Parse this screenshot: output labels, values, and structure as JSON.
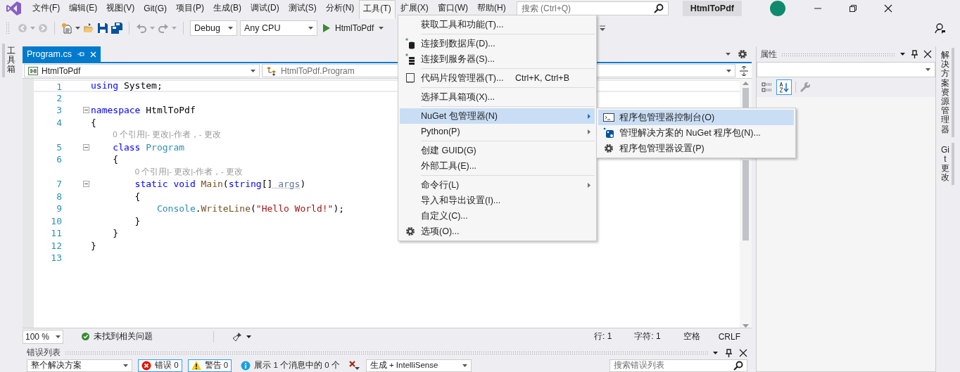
{
  "menu_bar": {
    "items": [
      {
        "label": "文件(F)",
        "selected": false
      },
      {
        "label": "编辑(E)",
        "selected": false
      },
      {
        "label": "视图(V)",
        "selected": false
      },
      {
        "label": "Git(G)",
        "selected": false
      },
      {
        "label": "项目(P)",
        "selected": false
      },
      {
        "label": "生成(B)",
        "selected": false
      },
      {
        "label": "调试(D)",
        "selected": false
      },
      {
        "label": "测试(S)",
        "selected": false
      },
      {
        "label": "分析(N)",
        "selected": false
      },
      {
        "label": "工具(T)",
        "selected": true
      },
      {
        "label": "扩展(X)",
        "selected": false
      },
      {
        "label": "窗口(W)",
        "selected": false
      },
      {
        "label": "帮助(H)",
        "selected": false
      }
    ]
  },
  "search": {
    "placeholder": "搜索 (Ctrl+Q)"
  },
  "window": {
    "title": "HtmlToPdf"
  },
  "toolbar": {
    "configuration": "Debug",
    "platform": "Any CPU",
    "start_target": "HtmlToPdf"
  },
  "left_strip": {
    "tabs": [
      "工具箱"
    ]
  },
  "editor": {
    "tabs": [
      {
        "label": "Program.cs",
        "selected": true
      }
    ],
    "project_dropdown": "HtmlToPdf",
    "member_dropdown": "HtmlToPdf.Program",
    "lines": [
      {
        "number": "1",
        "current": true,
        "fold": false,
        "tokens": [
          {
            "kind": "keyword",
            "text": "using"
          },
          {
            "kind": "plain",
            "text": " System;"
          }
        ]
      },
      {
        "number": "2",
        "current": false,
        "fold": false
      },
      {
        "number": "3",
        "current": false,
        "fold": true,
        "tokens": [
          {
            "kind": "keyword",
            "text": "namespace"
          },
          {
            "kind": "plain",
            "text": " HtmlToPdf"
          }
        ]
      },
      {
        "number": "4",
        "current": false,
        "fold": false,
        "tokens": [
          {
            "kind": "plain",
            "text": "{"
          }
        ]
      },
      {
        "number": "5",
        "current": false,
        "fold": true,
        "lens": "0 个引用|- 更改|-作者，- 更改",
        "tokens": [
          {
            "kind": "keyword",
            "text": "    class"
          },
          {
            "kind": "type",
            "text": " Program"
          }
        ]
      },
      {
        "number": "6",
        "current": false,
        "fold": false,
        "tokens": [
          {
            "kind": "plain",
            "text": "    {"
          }
        ]
      },
      {
        "number": "7",
        "current": false,
        "fold": true,
        "lens": "0 个引用|- 更改|-作者，- 更改",
        "tokens": [
          {
            "kind": "keyword",
            "text": "        static"
          },
          {
            "kind": "keyword",
            "text": " void"
          },
          {
            "kind": "method",
            "text": " Main"
          },
          {
            "kind": "plain",
            "text": "("
          },
          {
            "kind": "keyword",
            "text": "string"
          },
          {
            "kind": "plain",
            "text": "[]"
          },
          {
            "kind": "param",
            "text": " args"
          },
          {
            "kind": "plain",
            "text": ")"
          }
        ]
      },
      {
        "number": "8",
        "current": false,
        "fold": false,
        "tokens": [
          {
            "kind": "plain",
            "text": "        {"
          }
        ]
      },
      {
        "number": "9",
        "current": false,
        "fold": false,
        "tokens": [
          {
            "kind": "type",
            "text": "            Console"
          },
          {
            "kind": "plain",
            "text": "."
          },
          {
            "kind": "method",
            "text": "WriteLine"
          },
          {
            "kind": "plain",
            "text": "("
          },
          {
            "kind": "string",
            "text": "\"Hello World!\""
          },
          {
            "kind": "plain",
            "text": ");"
          }
        ]
      },
      {
        "number": "10",
        "current": false,
        "fold": false,
        "tokens": [
          {
            "kind": "plain",
            "text": "        }"
          }
        ]
      },
      {
        "number": "11",
        "current": false,
        "fold": false,
        "tokens": [
          {
            "kind": "plain",
            "text": "    }"
          }
        ]
      },
      {
        "number": "12",
        "current": false,
        "fold": false,
        "tokens": [
          {
            "kind": "plain",
            "text": "}"
          }
        ]
      },
      {
        "number": "13",
        "current": false,
        "fold": false
      }
    ]
  },
  "status_bar": {
    "zoom": "100 %",
    "issues": "未找到相关问题",
    "line": "行: 1",
    "char": "字符: 1",
    "whitespace": "空格",
    "line_ending": "CRLF"
  },
  "properties": {
    "title": "属性",
    "sort_modes": [
      {
        "kind": "categorized",
        "selected": false
      },
      {
        "kind": "alphabetical",
        "selected": true
      }
    ]
  },
  "right_strip": {
    "tabs": [
      "解决方案资源管理器",
      "Git 更改"
    ]
  },
  "error_list": {
    "title": "错误列表",
    "scope": "整个解决方案",
    "filters": [
      {
        "kind": "error",
        "label": "错误 0",
        "on": true
      },
      {
        "kind": "warning",
        "label": "警告 0",
        "on": true
      },
      {
        "kind": "message",
        "label": "展示 1 个消息中的 0 个",
        "on": false
      }
    ],
    "source": "生成 + IntelliSense",
    "search_placeholder": "搜索错误列表"
  },
  "tools_menu": {
    "items": [
      {
        "kind": "item",
        "label": "获取工具和功能(T)...",
        "has_submenu": false,
        "selected": false
      },
      {
        "kind": "separator"
      },
      {
        "kind": "item",
        "label": "连接到数据库(D)...",
        "has_submenu": false,
        "selected": false
      },
      {
        "kind": "item",
        "label": "连接到服务器(S)...",
        "has_submenu": false,
        "selected": false
      },
      {
        "kind": "separator"
      },
      {
        "kind": "item",
        "label": "代码片段管理器(T)...",
        "shortcut": "Ctrl+K, Ctrl+B",
        "has_submenu": false,
        "selected": false
      },
      {
        "kind": "separator"
      },
      {
        "kind": "item",
        "label": "选择工具箱项(X)...",
        "has_submenu": false,
        "selected": false
      },
      {
        "kind": "separator"
      },
      {
        "kind": "item",
        "label": "NuGet 包管理器(N)",
        "has_submenu": true,
        "selected": true
      },
      {
        "kind": "item",
        "label": "Python(P)",
        "has_submenu": true,
        "selected": false
      },
      {
        "kind": "separator"
      },
      {
        "kind": "item",
        "label": "创建 GUID(G)",
        "has_submenu": false,
        "selected": false
      },
      {
        "kind": "item",
        "label": "外部工具(E)...",
        "has_submenu": false,
        "selected": false
      },
      {
        "kind": "separator"
      },
      {
        "kind": "item",
        "label": "命令行(L)",
        "has_submenu": true,
        "selected": false
      },
      {
        "kind": "item",
        "label": "导入和导出设置(I)...",
        "has_submenu": false,
        "selected": false
      },
      {
        "kind": "item",
        "label": "自定义(C)...",
        "has_submenu": false,
        "selected": false
      },
      {
        "kind": "item",
        "label": "选项(O)...",
        "has_submenu": false,
        "selected": false
      }
    ]
  },
  "nuget_submenu": {
    "items": [
      {
        "kind": "item",
        "label": "程序包管理器控制台(O)",
        "has_submenu": false,
        "selected": true
      },
      {
        "kind": "item",
        "label": "管理解决方案的 NuGet 程序包(N)...",
        "has_submenu": false,
        "selected": false
      },
      {
        "kind": "item",
        "label": "程序包管理器设置(P)",
        "has_submenu": false,
        "selected": false
      }
    ]
  }
}
